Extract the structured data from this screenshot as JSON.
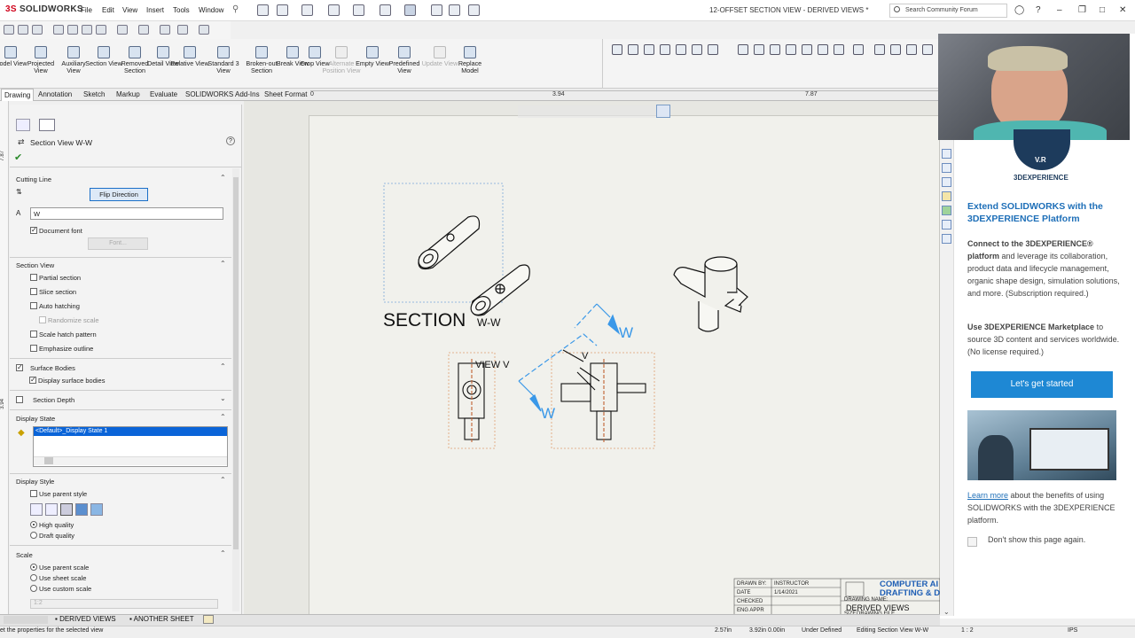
{
  "app": {
    "logo_prefix": "3S",
    "logo_text": "SOLIDWORKS",
    "menus": [
      "File",
      "Edit",
      "View",
      "Insert",
      "Tools",
      "Window"
    ],
    "document_title": "12-OFFSET SECTION VIEW - DERIVED VIEWS *",
    "search_placeholder": "Search Community Forum"
  },
  "command_manager": {
    "buttons": [
      {
        "label": "Model View",
        "enabled": true
      },
      {
        "label": "Projected View",
        "enabled": true
      },
      {
        "label": "Auxiliary View",
        "enabled": true
      },
      {
        "label": "Section View",
        "enabled": true
      },
      {
        "label": "Removed Section",
        "enabled": true
      },
      {
        "label": "Detail View",
        "enabled": true
      },
      {
        "label": "Relative View",
        "enabled": true
      },
      {
        "label": "Standard 3 View",
        "enabled": true
      },
      {
        "label": "Broken-out Section",
        "enabled": true
      },
      {
        "label": "Break View",
        "enabled": true
      },
      {
        "label": "Crop View",
        "enabled": true
      },
      {
        "label": "Alternate Position View",
        "enabled": false
      },
      {
        "label": "Empty View",
        "enabled": true
      },
      {
        "label": "Predefined View",
        "enabled": true
      },
      {
        "label": "Update View",
        "enabled": false
      },
      {
        "label": "Replace Model",
        "enabled": true
      }
    ],
    "tabs": [
      "Drawing",
      "Annotation",
      "Sketch",
      "Markup",
      "Evaluate",
      "SOLIDWORKS Add-Ins",
      "Sheet Format"
    ],
    "active_tab": "Drawing",
    "ruler_labels": [
      "0",
      "3.94",
      "7.87"
    ],
    "left_ruler_labels": [
      "7.87",
      "3.94"
    ]
  },
  "property_manager": {
    "title": "Section View W-W",
    "cutting_line": {
      "header": "Cutting Line",
      "flip_button": "Flip Direction",
      "label_value": "W",
      "document_font": "Document font",
      "document_font_checked": true,
      "font_button": "Font..."
    },
    "section_view": {
      "header": "Section View",
      "options": [
        {
          "label": "Partial section",
          "checked": false
        },
        {
          "label": "Slice section",
          "checked": false
        },
        {
          "label": "Auto hatching",
          "checked": false
        },
        {
          "label": "Randomize scale",
          "checked": false,
          "disabled": true
        },
        {
          "label": "Scale hatch pattern",
          "checked": false
        },
        {
          "label": "Emphasize outline",
          "checked": false
        }
      ]
    },
    "surface_bodies": {
      "header": "Surface Bodies",
      "checked": true,
      "option": "Display surface bodies",
      "option_checked": true
    },
    "section_depth": {
      "header": "Section Depth",
      "checked": false
    },
    "display_state": {
      "header": "Display State",
      "selected": "<Default>_Display State 1"
    },
    "display_style": {
      "header": "Display Style",
      "use_parent": "Use parent style",
      "use_parent_checked": false,
      "quality": [
        {
          "label": "High quality",
          "selected": true
        },
        {
          "label": "Draft quality",
          "selected": false
        }
      ]
    },
    "scale": {
      "header": "Scale",
      "options": [
        {
          "label": "Use parent scale",
          "selected": true
        },
        {
          "label": "Use sheet scale",
          "selected": false
        },
        {
          "label": "Use custom scale",
          "selected": false
        }
      ],
      "custom_value": "1:2"
    }
  },
  "drawing": {
    "section_label": "SECTION",
    "section_suffix": "W-W",
    "view_label": "VIEW V",
    "arrow_letter_v": "V",
    "arrow_letter_w1": "W",
    "arrow_letter_w2": "W",
    "title_block": {
      "rows": [
        {
          "label": "DRAWN BY:",
          "value": "INSTRUCTOR"
        },
        {
          "label": "DATE",
          "value": "1/14/2021"
        },
        {
          "label": "CHECKED",
          "value": ""
        },
        {
          "label": "ENG APPR",
          "value": ""
        }
      ],
      "company_line1": "COMPUTER AI",
      "company_line2": "DRAFTING & DE",
      "drawing_name_label": "DRAWING NAME:",
      "drawing_name": "DERIVED VIEWS",
      "size_label": "SIZE",
      "drawing_file_label": "DRAWING FILE"
    }
  },
  "sheet_tabs": [
    "DERIVED VIEWS",
    "ANOTHER SHEET"
  ],
  "status_bar": {
    "left": "et the properties for the selected view",
    "x": "2.57in",
    "y_z": "3.92in 0.00in",
    "definition": "Under Defined",
    "editing": "Editing Section View W-W",
    "scale": "1 : 2",
    "units": "IPS"
  },
  "task_pane": {
    "brand": "3DEXPERIENCE",
    "logo_badge": "V.R",
    "heading": "Extend SOLIDWORKS with the 3DEXPERIENCE Platform",
    "p1_bold": "Connect to the 3DEXPERIENCE® platform",
    "p1_rest": " and leverage its collaboration, product data and lifecycle management, organic shape design, simulation solutions, and more. (Subscription required.)",
    "p2_bold": "Use 3DEXPERIENCE Marketplace",
    "p2_rest": " to source 3D content and services worldwide. (No license required.)",
    "cta": "Let's get started",
    "learn_link": "Learn more",
    "learn_rest": " about the benefits of using SOLIDWORKS with the 3DEXPERIENCE platform.",
    "dont_show": "Don't show this page again."
  },
  "colors": {
    "accent_blue": "#1e88d4",
    "highlight": "#0a64d8",
    "solidworks_red": "#d0021b",
    "cutting_line": "#3a98e8"
  }
}
